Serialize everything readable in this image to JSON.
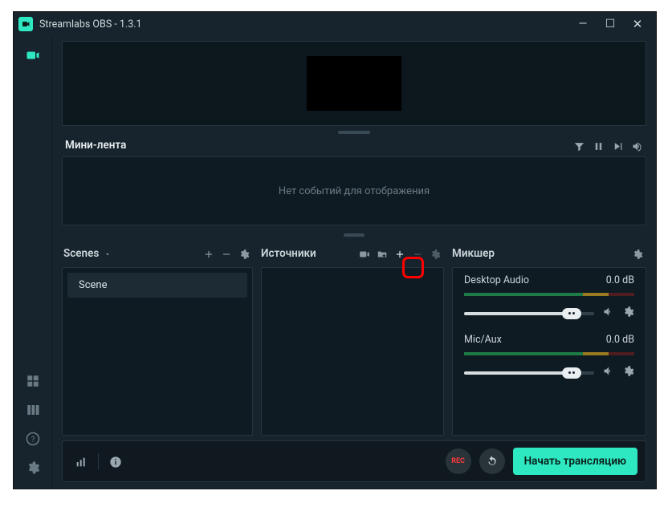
{
  "title": "Streamlabs OBS - 1.3.1",
  "feed": {
    "title": "Мини-лента",
    "empty": "Нет событий для отображения"
  },
  "panels": {
    "scenes": {
      "title": "Scenes",
      "item": "Scene"
    },
    "sources": {
      "title": "Источники"
    },
    "mixer": {
      "title": "Микшер",
      "tracks": [
        {
          "name": "Desktop Audio",
          "level": "0.0 dB"
        },
        {
          "name": "Mic/Aux",
          "level": "0.0 dB"
        }
      ]
    }
  },
  "bottom": {
    "rec": "REC",
    "go": "Начать трансляцию"
  }
}
